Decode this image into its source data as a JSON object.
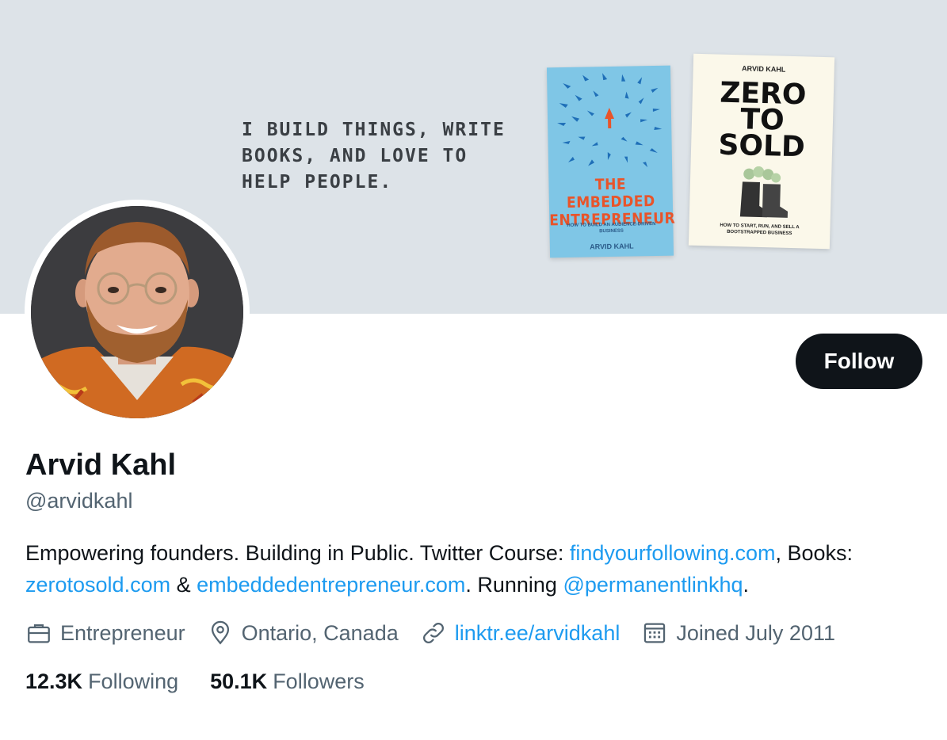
{
  "banner": {
    "tagline": "I BUILD THINGS, WRITE\nBOOKS, AND LOVE TO\nHELP PEOPLE.",
    "book1": {
      "title": "THE EMBEDDED ENTREPRENEUR",
      "subtitle": "HOW TO BUILD AN AUDIENCE-DRIVEN BUSINESS",
      "author": "ARVID KAHL"
    },
    "book2": {
      "author": "ARVID KAHL",
      "title": "ZERO\nTO\nSOLD",
      "subtitle": "HOW TO START, RUN, AND SELL A BOOTSTRAPPED BUSINESS"
    }
  },
  "profile": {
    "follow_label": "Follow",
    "name": "Arvid Kahl",
    "handle": "@arvidkahl",
    "bio": {
      "text1": "Empowering founders. Building in Public. Twitter Course: ",
      "link1": "findyourfollowing.com",
      "text2": ", Books: ",
      "link2": "zerotosold.com",
      "text3": " & ",
      "link3": "embeddedentrepreneur.com",
      "text4": ". Running ",
      "link4": "@permanentlinkhq",
      "text5": "."
    },
    "meta": {
      "profession": "Entrepreneur",
      "location": "Ontario, Canada",
      "website": "linktr.ee/arvidkahl",
      "joined": "Joined July 2011"
    },
    "stats": {
      "following_count": "12.3K",
      "following_label": "Following",
      "followers_count": "50.1K",
      "followers_label": "Followers"
    }
  },
  "colors": {
    "link": "#1d9bf0",
    "banner_bg": "#dde3e8",
    "button_bg": "#0f1419",
    "secondary_text": "#536471"
  },
  "icons": [
    "briefcase-icon",
    "location-pin-icon",
    "link-icon",
    "calendar-icon"
  ]
}
